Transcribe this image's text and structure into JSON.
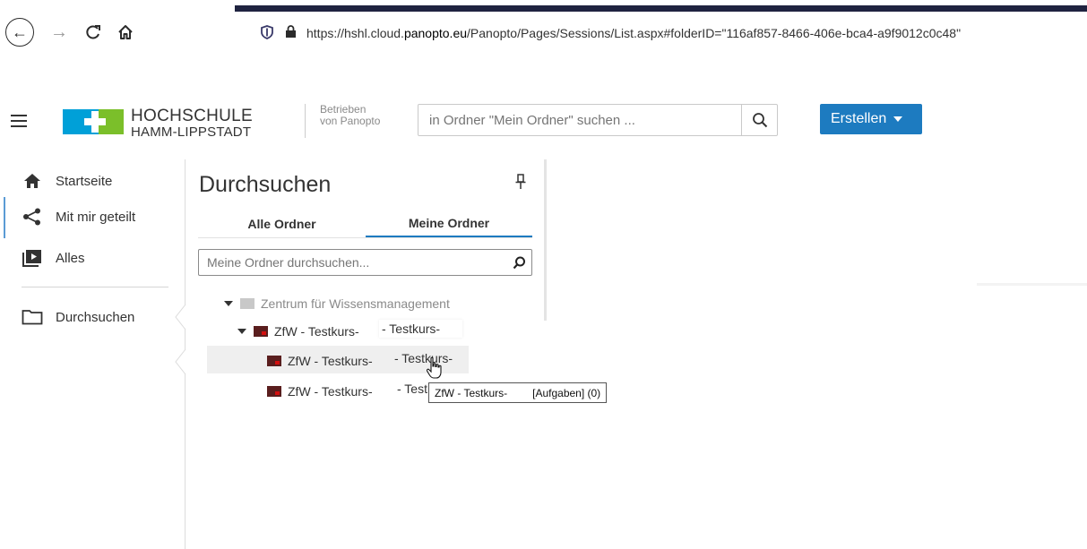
{
  "browser": {
    "url_prefix": "https://hshl.cloud.",
    "url_domain": "panopto.eu",
    "url_suffix": "/Panopto/Pages/Sessions/List.aspx#folderID=\"116af857-8466-406e-bca4-a9f9012c0c48\"",
    "back_icon": "←",
    "forward_icon": "→",
    "reload_icon": "C",
    "home_icon": "⌂"
  },
  "header": {
    "logo_line1": "HOCHSCHULE",
    "logo_line2": "HAMM-LIPPSTADT",
    "powered_line1": "Betrieben",
    "powered_line2": "von Panopto",
    "search_placeholder": "in Ordner \"Mein Ordner\" suchen ...",
    "create_label": "Erstellen",
    "accent_color": "#1d7bc0"
  },
  "sidebar": {
    "items": [
      {
        "label": "Startseite",
        "icon": "home-icon"
      },
      {
        "label": "Mit mir geteilt",
        "icon": "share-icon"
      },
      {
        "label": "Alles",
        "icon": "play-icon"
      },
      {
        "label": "Durchsuchen",
        "icon": "folder-outline-icon"
      }
    ]
  },
  "browse": {
    "title": "Durchsuchen",
    "tabs": [
      {
        "label": "Alle Ordner",
        "active": false
      },
      {
        "label": "Meine Ordner",
        "active": true
      }
    ],
    "search_placeholder": "Meine Ordner durchsuchen...",
    "tree": [
      {
        "label": "Zentrum für Wissensmanagement",
        "expanded": true
      },
      {
        "label": "ZfW - Testkurs-",
        "overflow": "- Testkurs-",
        "expanded": true
      },
      {
        "label": "ZfW - Testkurs-",
        "overflow": "- Testkurs-",
        "hovered": true
      },
      {
        "label": "ZfW - Testkurs-",
        "overflow": "- Test"
      }
    ],
    "tooltip_name": "ZfW - Testkurs-",
    "tooltip_suffix": "[Aufgaben] (0)"
  }
}
